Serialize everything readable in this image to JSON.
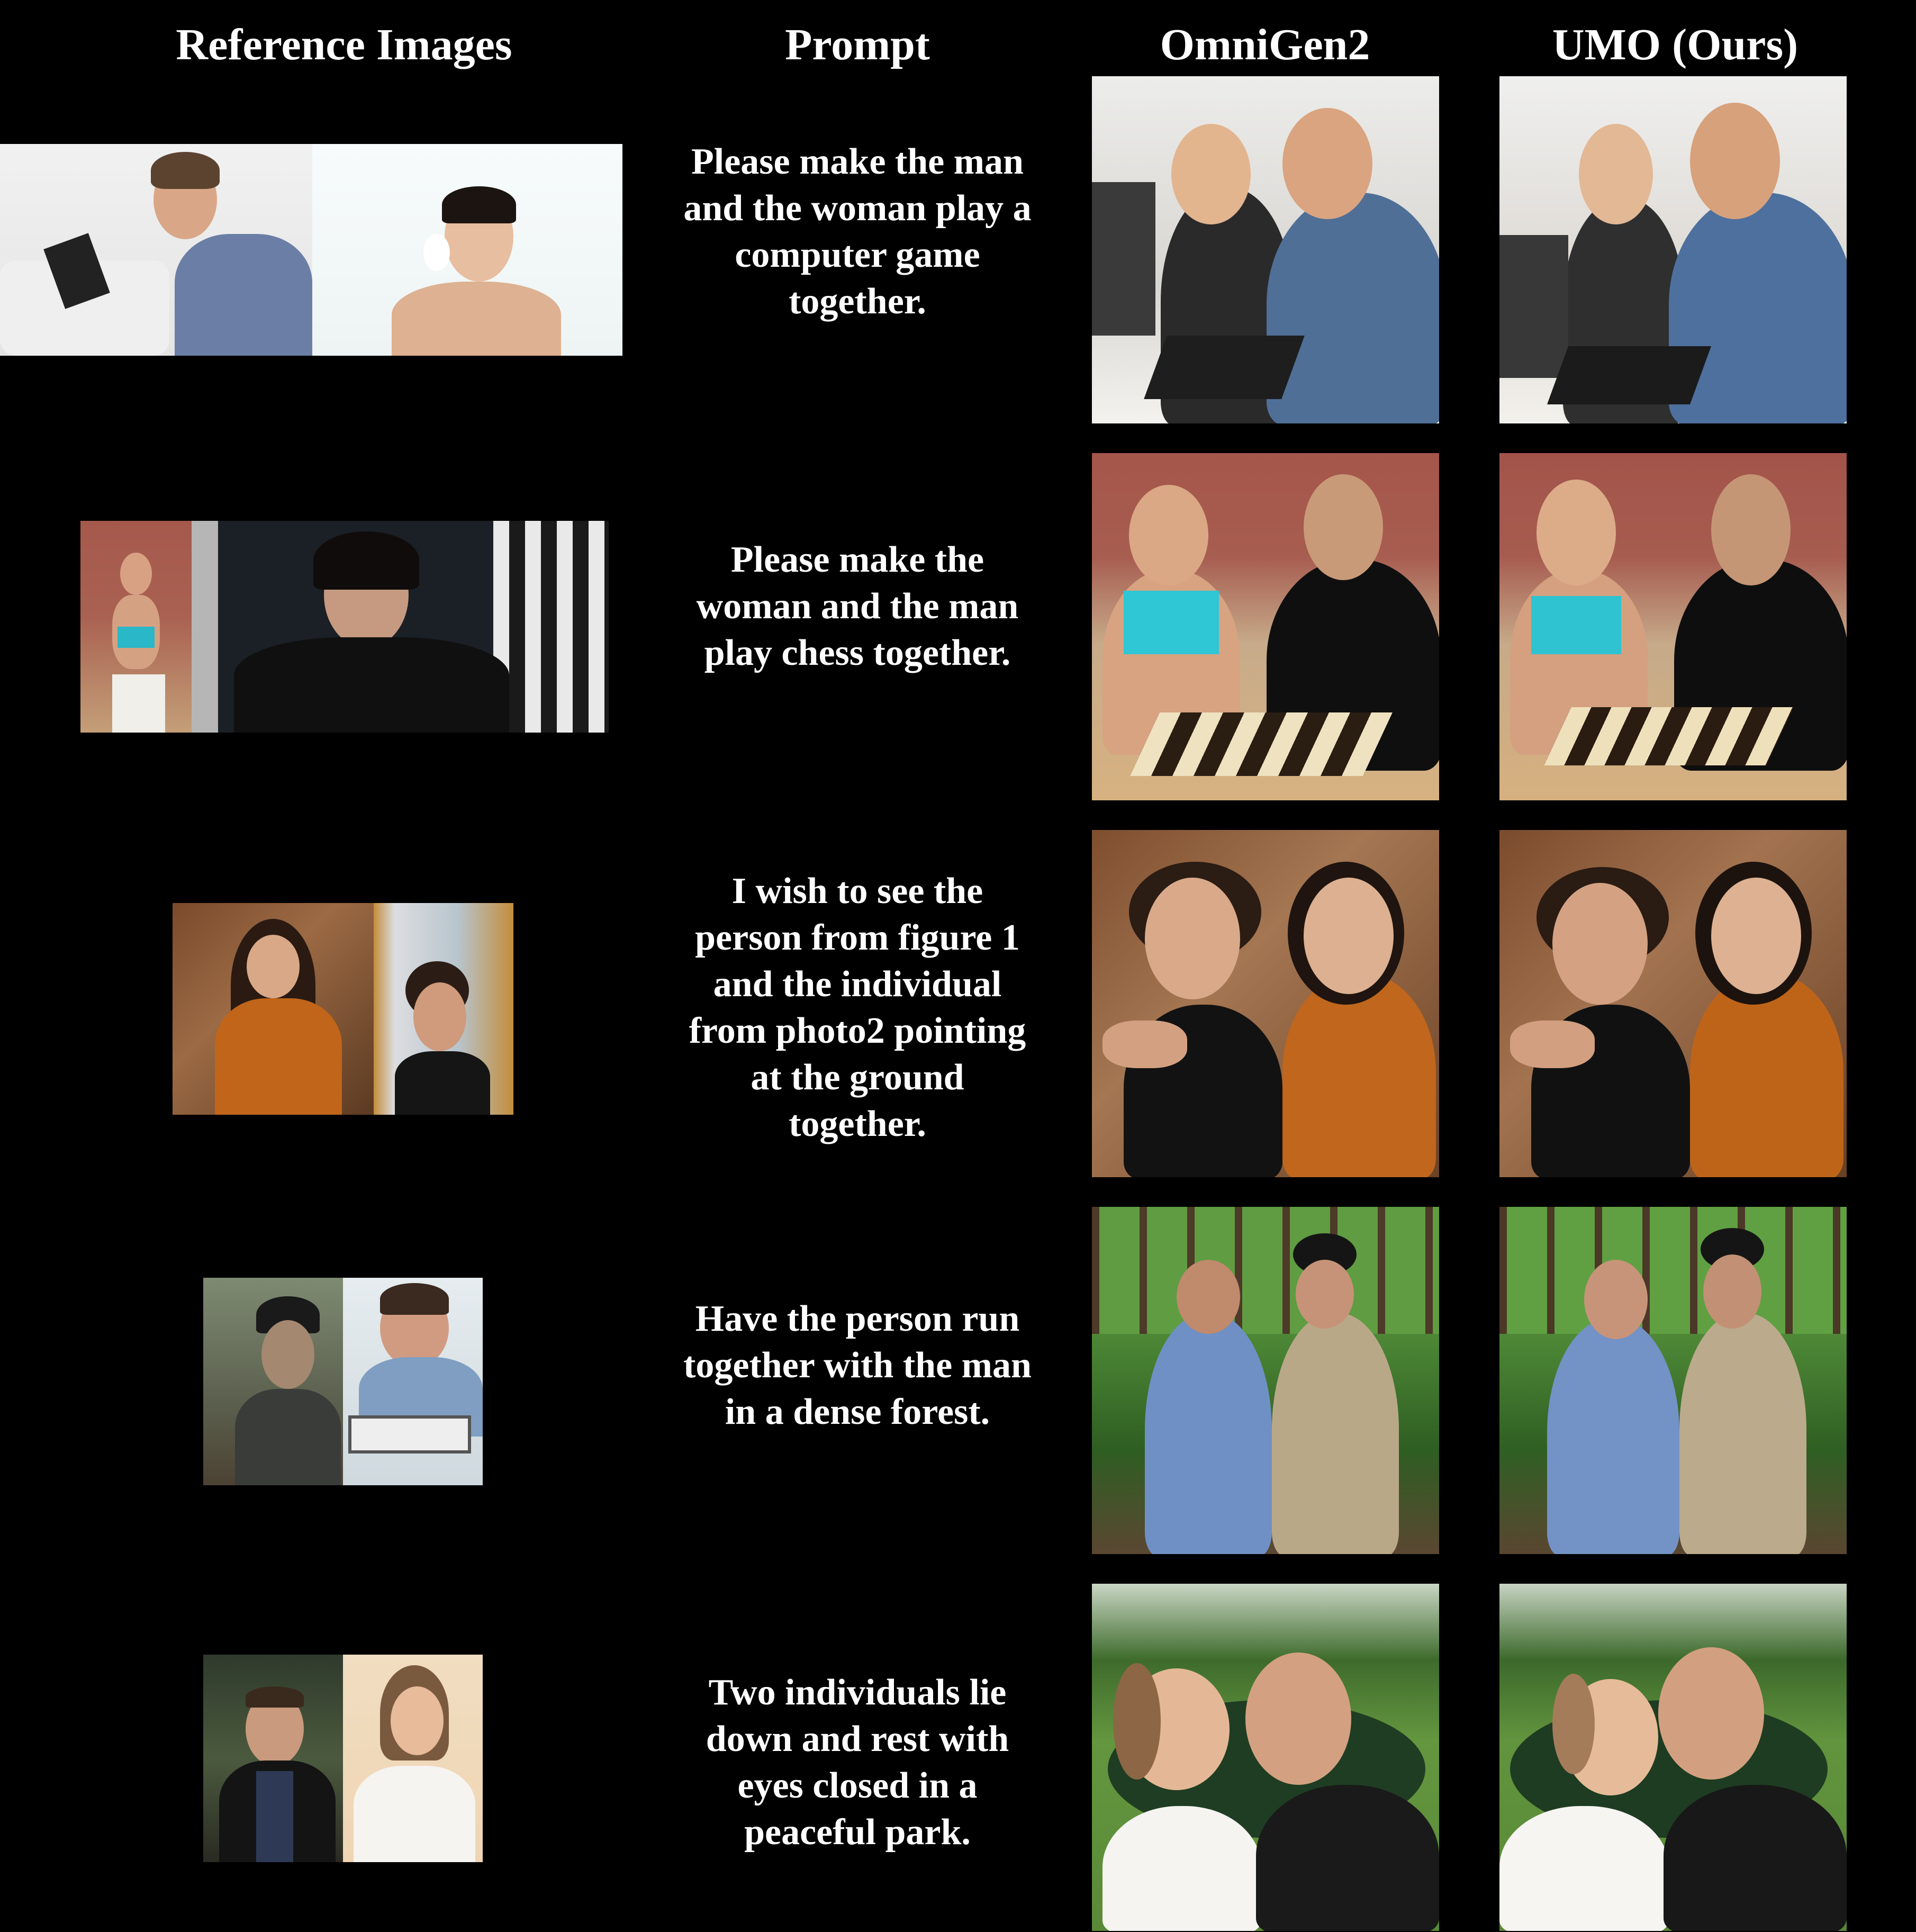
{
  "headers": {
    "reference": "Reference Images",
    "prompt": "Prompt",
    "omnigen": "OmniGen2",
    "umo": "UMO (Ours)"
  },
  "rows": [
    {
      "prompt": "Please make the man and the woman play a computer game together.",
      "reference_images": [
        "man-with-tablet-photo",
        "woman-portrait-photo"
      ],
      "omnigen_image": "couple-playing-computer-game-photo",
      "umo_image": "couple-playing-computer-game-photo"
    },
    {
      "prompt": "Please make the woman and the man play chess together.",
      "reference_images": [
        "woman-in-bikini-photo",
        "man-in-dark-robe-photo"
      ],
      "omnigen_image": "couple-playing-chess-photo",
      "umo_image": "couple-playing-chess-photo"
    },
    {
      "prompt": "I wish to see the person from figure 1 and the individual from photo2 pointing at the ground together.",
      "reference_images": [
        "woman-orange-sweater-photo",
        "woman-curly-hair-photo"
      ],
      "omnigen_image": "two-women-pointing-photo",
      "umo_image": "two-women-pointing-photo"
    },
    {
      "prompt": "Have the person run together with the man in a dense forest.",
      "reference_images": [
        "man-in-beanie-photo",
        "man-on-scale-photo"
      ],
      "omnigen_image": "two-men-running-forest-photo",
      "umo_image": "two-men-running-forest-photo"
    },
    {
      "prompt": "Two individuals lie down and rest with eyes closed in a peaceful park.",
      "reference_images": [
        "man-leather-jacket-photo",
        "woman-white-shirt-photo"
      ],
      "omnigen_image": "couple-resting-park-photo",
      "umo_image": "couple-resting-park-photo"
    }
  ]
}
